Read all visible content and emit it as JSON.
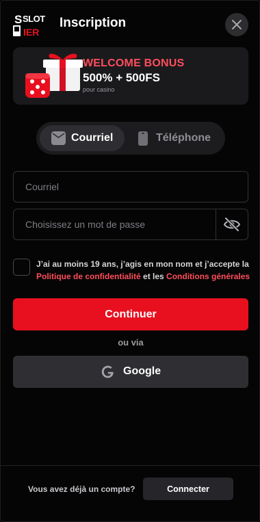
{
  "header": {
    "logo_line1": "SLOT",
    "logo_line2": "IER",
    "title": "Inscription",
    "close_icon": "close-icon"
  },
  "bonus": {
    "title": "WELCOME BONUS",
    "amount": "500% + 500FS",
    "subtitle": "pour casino"
  },
  "tabs": [
    {
      "label": "Courriel",
      "icon": "envelope-icon",
      "active": true
    },
    {
      "label": "Téléphone",
      "icon": "phone-icon",
      "active": false
    }
  ],
  "form": {
    "email_placeholder": "Courriel",
    "password_placeholder": "Choisissez un mot de passe",
    "password_toggle_icon": "eye-off-icon"
  },
  "terms": {
    "text_before": "J’ai au moins 19 ans, j’agis en mon nom et j’accepte la ",
    "privacy_link": "Politique de confidentialité",
    "text_middle": " et les ",
    "terms_link": "Conditions générales"
  },
  "actions": {
    "continue_label": "Continuer",
    "or_label": "ou via",
    "google_label": "Google"
  },
  "footer": {
    "question": "Vous avez déjà un compte?",
    "login_label": "Connecter"
  },
  "colors": {
    "accent": "#e8101f",
    "link": "#ff4e5b",
    "background": "#050505"
  }
}
